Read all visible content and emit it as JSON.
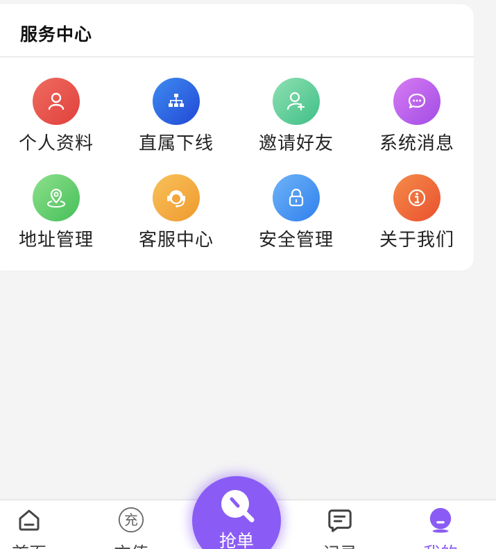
{
  "service_center": {
    "title": "服务中心",
    "items": [
      {
        "label": "个人资料",
        "icon": "person-icon",
        "color_from": "#ef6b5f",
        "color_to": "#e0413d"
      },
      {
        "label": "直属下线",
        "icon": "org-chart-icon",
        "color_from": "#3f8bf0",
        "color_to": "#2148d6"
      },
      {
        "label": "邀请好友",
        "icon": "add-friend-icon",
        "color_from": "#8fe0b2",
        "color_to": "#3fbf87"
      },
      {
        "label": "系统消息",
        "icon": "chat-bubble-icon",
        "color_from": "#d67cf2",
        "color_to": "#a24ce6"
      },
      {
        "label": "地址管理",
        "icon": "location-pin-icon",
        "color_from": "#8ee08a",
        "color_to": "#45bf5a"
      },
      {
        "label": "客服中心",
        "icon": "headset-icon",
        "color_from": "#f8c15a",
        "color_to": "#ef9a2e"
      },
      {
        "label": "安全管理",
        "icon": "lock-icon",
        "color_from": "#6fb3f7",
        "color_to": "#2f80ed"
      },
      {
        "label": "关于我们",
        "icon": "info-icon",
        "color_from": "#f58c4a",
        "color_to": "#e9502f"
      }
    ]
  },
  "tabbar": {
    "accent": "#8a5cf5",
    "tabs": [
      {
        "label": "首页",
        "icon": "home-icon"
      },
      {
        "label": "充值",
        "icon": "recharge-icon"
      },
      {
        "label": "抢单",
        "icon": "grab-order-icon"
      },
      {
        "label": "记录",
        "icon": "record-icon"
      },
      {
        "label": "我的",
        "icon": "profile-icon",
        "active": true
      }
    ]
  }
}
